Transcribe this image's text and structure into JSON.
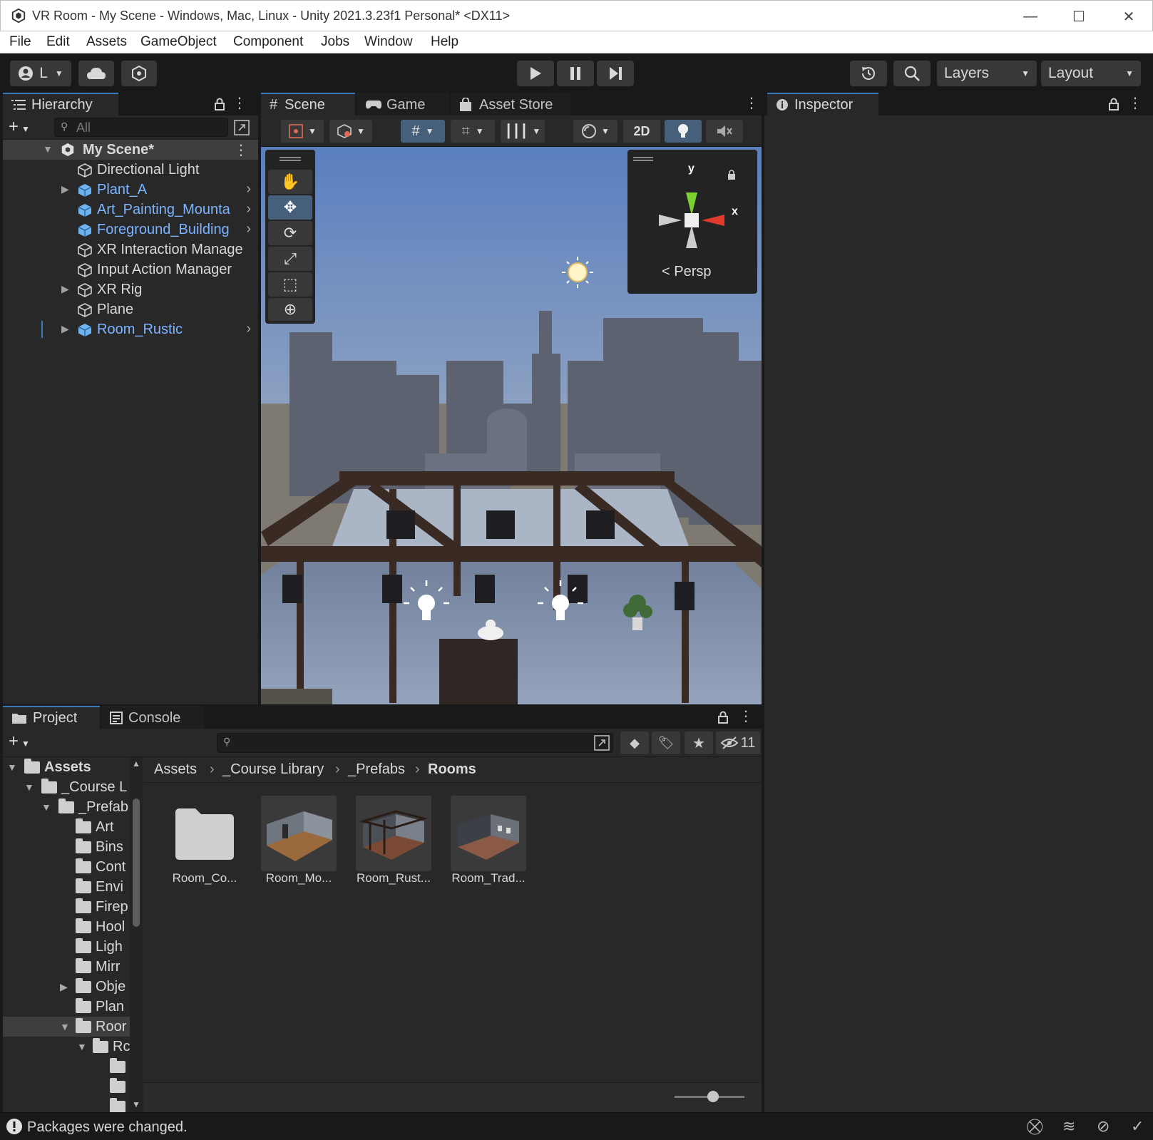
{
  "window": {
    "title": "VR Room - My Scene - Windows, Mac, Linux - Unity 2021.3.23f1 Personal* <DX11>",
    "minimize": "—",
    "maximize": "☐",
    "close": "✕"
  },
  "menu": [
    "File",
    "Edit",
    "Assets",
    "GameObject",
    "Component",
    "Jobs",
    "Window",
    "Help"
  ],
  "toolbar": {
    "account_label": "L",
    "layers_label": "Layers",
    "layout_label": "Layout"
  },
  "hierarchy": {
    "tab_label": "Hierarchy",
    "search_placeholder": "All",
    "scene_name": "My Scene*",
    "items": [
      {
        "label": "Directional Light",
        "prefab": false,
        "expandable": false
      },
      {
        "label": "Plant_A",
        "prefab": true,
        "expandable": true
      },
      {
        "label": "Art_Painting_Mounta",
        "prefab": true,
        "expandable": true
      },
      {
        "label": "Foreground_Building",
        "prefab": true,
        "expandable": true
      },
      {
        "label": "XR Interaction Manage",
        "prefab": false,
        "expandable": false
      },
      {
        "label": "Input Action Manager",
        "prefab": false,
        "expandable": false
      },
      {
        "label": "XR Rig",
        "prefab": false,
        "expandable": true
      },
      {
        "label": "Plane",
        "prefab": false,
        "expandable": false
      },
      {
        "label": "Room_Rustic",
        "prefab": true,
        "expandable": true
      }
    ]
  },
  "scene": {
    "tabs": [
      "Scene",
      "Game",
      "Asset Store"
    ],
    "mode_2d": "2D",
    "gizmo": {
      "y": "y",
      "x": "x",
      "projection": "Persp"
    }
  },
  "inspector": {
    "tab_label": "Inspector"
  },
  "project": {
    "tabs": [
      "Project",
      "Console"
    ],
    "hidden_count": "11",
    "breadcrumb": [
      "Assets",
      "_Course Library",
      "_Prefabs",
      "Rooms"
    ],
    "tree": [
      {
        "label": "Assets",
        "depth": 0,
        "expanded": true,
        "bold": true
      },
      {
        "label": "_Course L",
        "depth": 1,
        "expanded": true
      },
      {
        "label": "_Prefab",
        "depth": 2,
        "expanded": true
      },
      {
        "label": "Art",
        "depth": 3
      },
      {
        "label": "Bins",
        "depth": 3
      },
      {
        "label": "Cont",
        "depth": 3
      },
      {
        "label": "Envi",
        "depth": 3
      },
      {
        "label": "Firep",
        "depth": 3
      },
      {
        "label": "Hool",
        "depth": 3
      },
      {
        "label": "Ligh",
        "depth": 3
      },
      {
        "label": "Mirr",
        "depth": 3
      },
      {
        "label": "Obje",
        "depth": 3,
        "collapsed": true
      },
      {
        "label": "Plan",
        "depth": 3
      },
      {
        "label": "Roor",
        "depth": 3,
        "expanded": true,
        "selected": true
      },
      {
        "label": "Rc",
        "depth": 4,
        "expanded": true
      },
      {
        "label": "",
        "depth": 5
      },
      {
        "label": "",
        "depth": 5
      },
      {
        "label": "",
        "depth": 5
      }
    ],
    "assets": [
      {
        "label": "Room_Co...",
        "kind": "folder"
      },
      {
        "label": "Room_Mo...",
        "kind": "prefab"
      },
      {
        "label": "Room_Rust...",
        "kind": "prefab"
      },
      {
        "label": "Room_Trad...",
        "kind": "prefab"
      }
    ]
  },
  "status": {
    "message": "Packages were changed."
  },
  "colors": {
    "accent": "#3a79bb",
    "prefab_blue": "#7cb4ff",
    "panel_bg": "#282828",
    "frame_bg": "#191919"
  }
}
